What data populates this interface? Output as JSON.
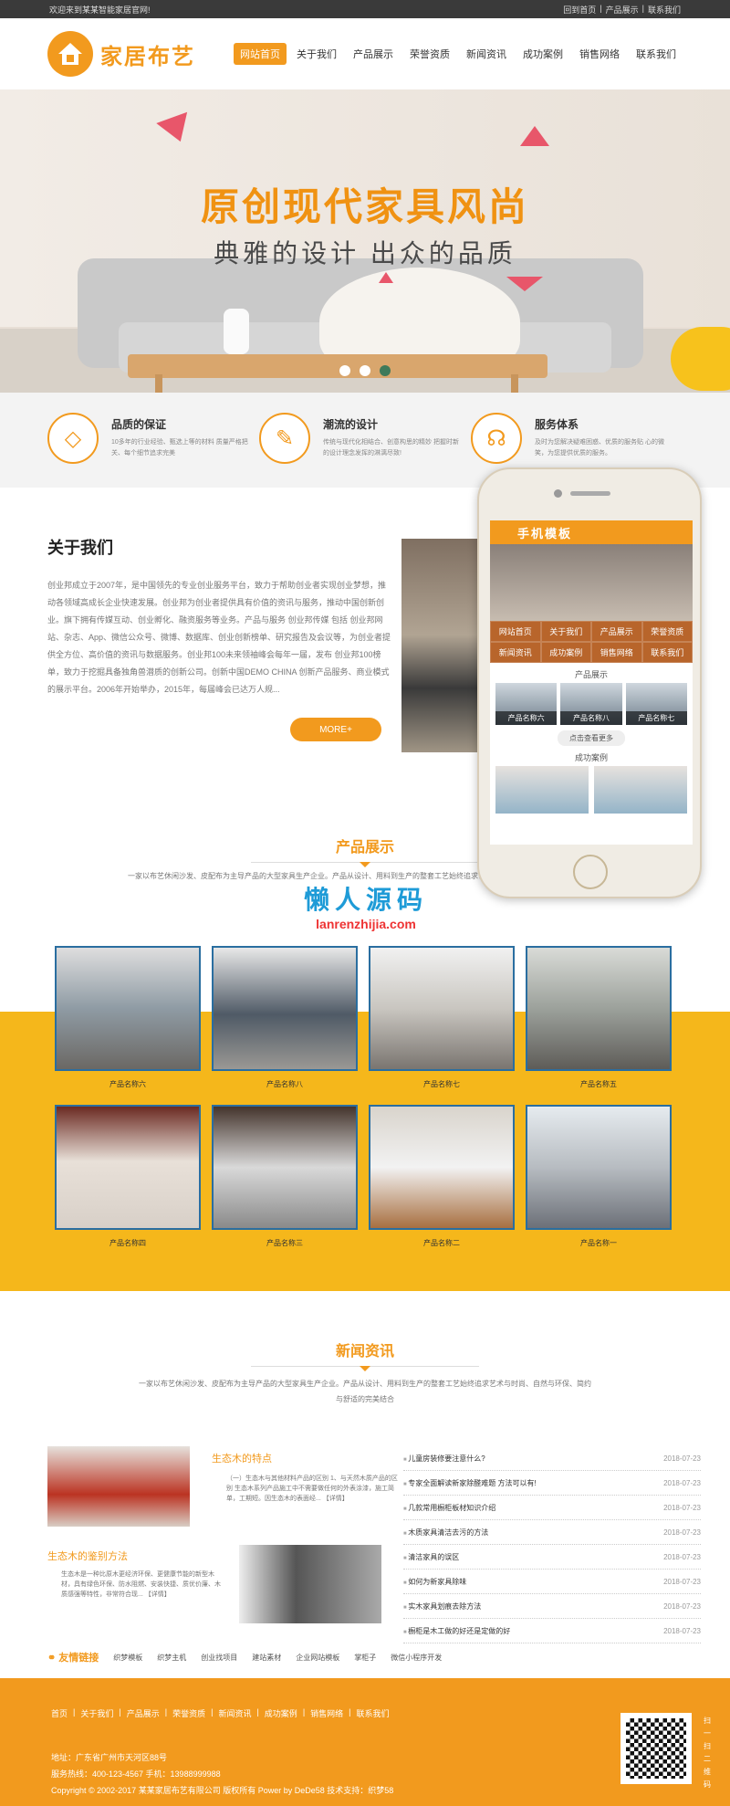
{
  "topbar": {
    "welcome": "欢迎来到某某智能家居官网!",
    "links": [
      "回到首页",
      "产品展示",
      "联系我们"
    ]
  },
  "logo": {
    "text": "家居布艺"
  },
  "nav": [
    "网站首页",
    "关于我们",
    "产品展示",
    "荣誉资质",
    "新闻资讯",
    "成功案例",
    "销售网络",
    "联系我们"
  ],
  "banner": {
    "title": "原创现代家具风尚",
    "subtitle": "典雅的设计  出众的品质"
  },
  "features": [
    {
      "title": "品质的保证",
      "desc": "10多年的行业经验、甄选上等的材料 质量严格把关、每个细节追求完美",
      "icon": "diamond-icon"
    },
    {
      "title": "潮流的设计",
      "desc": "传统与现代化相结合、创意构思的精妙 把握时新的设计理念发挥的淋漓尽致!",
      "icon": "pen-icon"
    },
    {
      "title": "服务体系",
      "desc": "及时为您解决疑难困惑、优质的服务贴 心的微笑，为您提供优质的服务。",
      "icon": "headset-icon"
    }
  ],
  "about": {
    "title": "关于我们",
    "text": "创业邦成立于2007年，是中国领先的专业创业服务平台，致力于帮助创业者实现创业梦想，推动各领域高成长企业快速发展。创业邦为创业者提供具有价值的资讯与服务，推动中国创新创业。旗下拥有传媒互动、创业孵化、融资服务等业务。产品与服务 创业邦传媒 包括 创业邦网站、杂志、App、微信公众号、微博、数据库、创业创新榜单、研究报告及会议等，为创业者提供全方位、高价值的资讯与数据服务。创业邦100未来领袖峰会每年一届，发布 创业邦100榜单，致力于挖掘具备独角兽潜质的创新公司。创新中国DEMO CHINA 创新产品服务、商业模式的展示平台。2006年开始举办，2015年，每届峰会已达万人规...",
    "more": "MORE+"
  },
  "phone": {
    "header": "手机模板",
    "nav": [
      "网站首页",
      "关于我们",
      "产品展示",
      "荣誉资质",
      "新闻资讯",
      "成功案例",
      "销售网络",
      "联系我们"
    ],
    "section1": "产品展示",
    "cards": [
      "产品名称六",
      "产品名称八",
      "产品名称七"
    ],
    "button": "点击查看更多",
    "section2": "成功案例"
  },
  "watermark": {
    "title": "懒人源码",
    "url": "lanrenzhijia.com"
  },
  "products": {
    "title": "产品展示",
    "desc": "一家以布艺休闲沙发、皮配布为主导产品的大型家具生产企业。产品从设计、用料到生产的整套工艺始终追求艺术与时尚、自然与环保、简约与舒适的完美结合",
    "items": [
      "产品名称六",
      "产品名称八",
      "产品名称七",
      "产品名称五",
      "产品名称四",
      "产品名称三",
      "产品名称二",
      "产品名称一"
    ]
  },
  "news": {
    "title": "新闻资讯",
    "desc": "一家以布艺休闲沙发、皮配布为主导产品的大型家具生产企业。产品从设计、用料到生产的整套工艺始终追求艺术与时尚、自然与环保、简约与舒适的完美结合",
    "feature1": {
      "title": "生态木的特点",
      "desc": "（一）生态木与其他材料产品的区别 1、与天然木质产品的区别 生态木系列产品施工中不需要做任何的外表涂漆，施工简单，工期短。因生态木的表面经... 【详情】"
    },
    "feature2": {
      "title": "生态木的鉴别方法",
      "desc": "生态木是一种比原木更经济环保、更健康节能的新型木材，具有绿色环保、防水阻燃、安装快捷、质优价廉、木质感强等特性，非常符合现... 【详情】"
    },
    "list": [
      {
        "t": "儿童房装修要注意什么?",
        "d": "2018-07-23"
      },
      {
        "t": "专家全面解读新家除醛难题 方法可以有!",
        "d": "2018-07-23"
      },
      {
        "t": "几款常用橱柜板材知识介绍",
        "d": "2018-07-23"
      },
      {
        "t": "木质家具清洁去污的方法",
        "d": "2018-07-23"
      },
      {
        "t": "清洁家具的误区",
        "d": "2018-07-23"
      },
      {
        "t": "如何为新家具除味",
        "d": "2018-07-23"
      },
      {
        "t": "实木家具划痕去除方法",
        "d": "2018-07-23"
      },
      {
        "t": "橱柜是木工做的好还是定做的好",
        "d": "2018-07-23"
      }
    ]
  },
  "friendlinks": {
    "title": "友情链接",
    "items": [
      "织梦模板",
      "织梦主机",
      "创业找项目",
      "建站素材",
      "企业网站模板",
      "掌柜子",
      "微信小程序开发"
    ]
  },
  "footer": {
    "nav": [
      "首页",
      "关于我们",
      "产品展示",
      "荣誉资质",
      "新闻资讯",
      "成功案例",
      "销售网络",
      "联系我们"
    ],
    "address": "地址：广东省广州市天河区88号",
    "phone": "服务热线：400-123-4567 手机：13988999988",
    "copyright": "Copyright © 2002-2017 某某家居布艺有限公司 版权所有 Power by DeDe58 技术支持：织梦58",
    "side": "扫一扫二维码"
  }
}
